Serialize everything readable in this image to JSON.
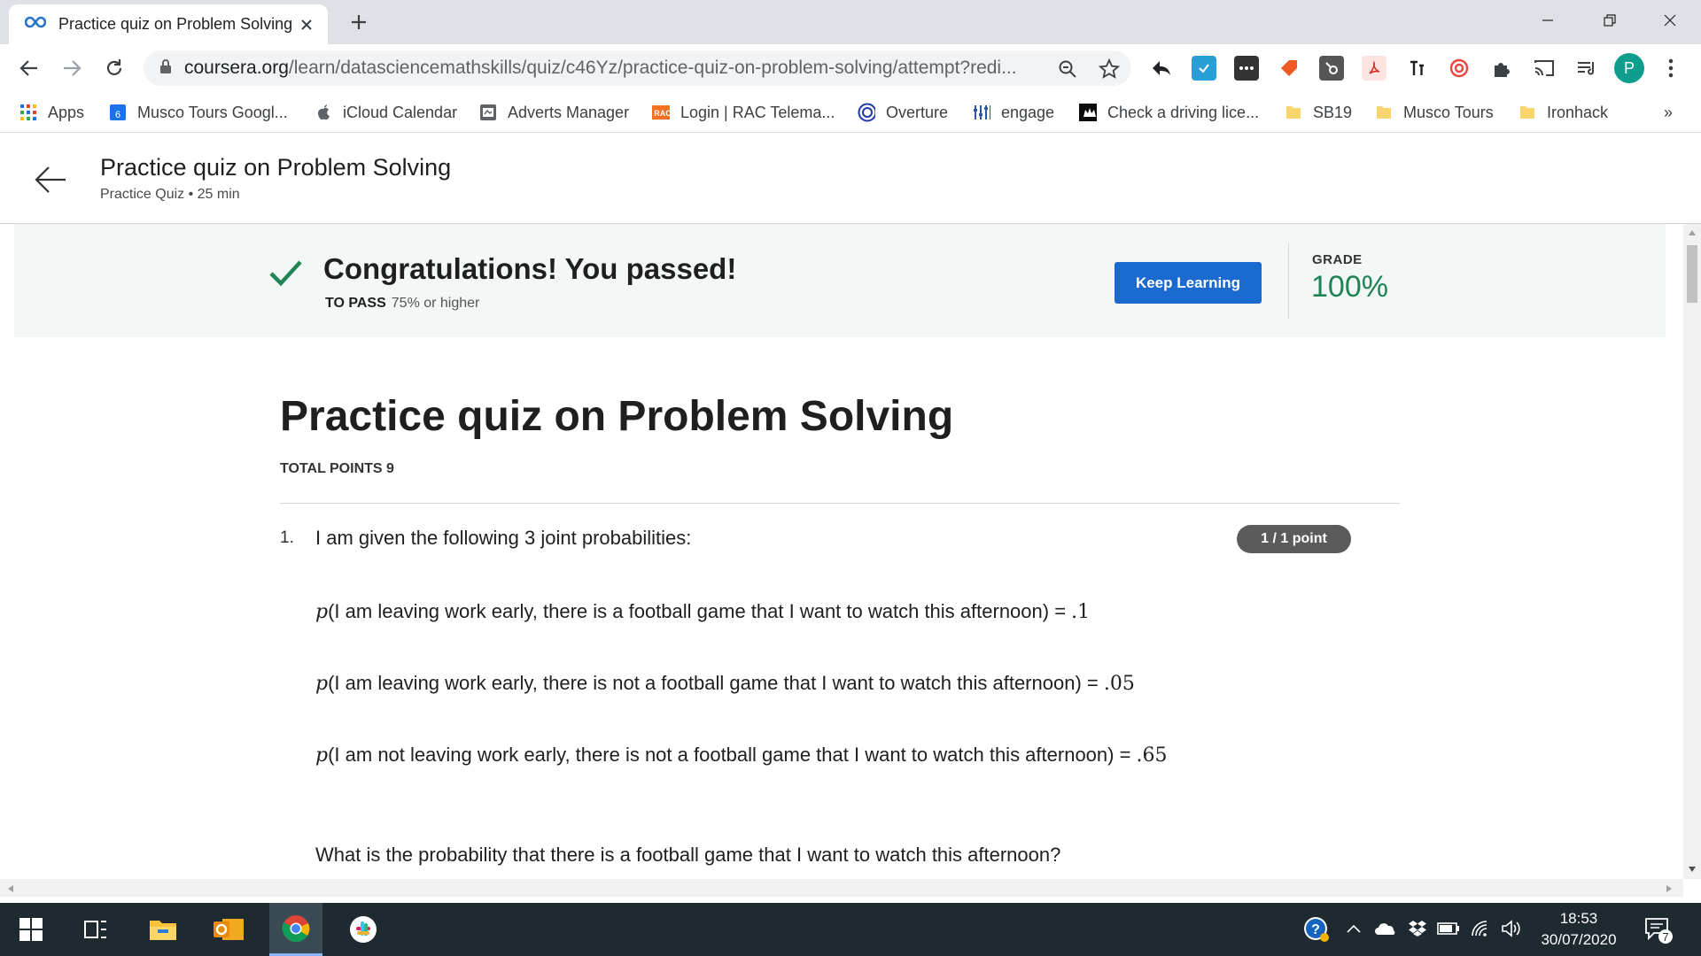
{
  "browser": {
    "tab_title": "Practice quiz on Problem Solving",
    "url_main": "coursera.org",
    "url_rest": "/learn/datasciencemathskills/quiz/c46Yz/practice-quiz-on-problem-solving/attempt?redi...",
    "profile_initial": "P",
    "bookmarks": [
      {
        "label": "Apps",
        "icon": "apps-grid-icon"
      },
      {
        "label": "Musco Tours Googl...",
        "icon": "google-calendar-icon"
      },
      {
        "label": "iCloud Calendar",
        "icon": "apple-icon"
      },
      {
        "label": "Adverts Manager",
        "icon": "adverts-icon"
      },
      {
        "label": "Login | RAC Telema...",
        "icon": "rac-icon"
      },
      {
        "label": "Overture",
        "icon": "overture-icon"
      },
      {
        "label": "engage",
        "icon": "engage-icon"
      },
      {
        "label": "Check a driving lice...",
        "icon": "gov-crown-icon"
      },
      {
        "label": "SB19",
        "icon": "folder-icon"
      },
      {
        "label": "Musco Tours",
        "icon": "folder-icon"
      },
      {
        "label": "Ironhack",
        "icon": "folder-icon"
      }
    ],
    "bookmarks_overflow": "»"
  },
  "header": {
    "title": "Practice quiz on Problem Solving",
    "subtitle": "Practice Quiz • 25 min"
  },
  "banner": {
    "title": "Congratulations! You passed!",
    "to_pass_label": "TO PASS",
    "to_pass_value": "75% or higher",
    "button": "Keep Learning",
    "grade_label": "GRADE",
    "grade_value": "100%",
    "accent_green": "#1f8354",
    "button_blue": "#1b6ad0"
  },
  "quiz": {
    "title": "Practice quiz on Problem Solving",
    "total_points": "TOTAL POINTS 9",
    "question_number": "1.",
    "question_text": "I am given the following 3 joint probabilities:",
    "points_badge": "1 / 1 point",
    "statements": [
      {
        "fn": "p",
        "text": "(I am leaving work early, there is a football game that I want to watch this afternoon) = ",
        "value": ".1"
      },
      {
        "fn": "p",
        "text": "(I am leaving work early, there is not a football game that I want to watch this afternoon) = ",
        "value": ".05"
      },
      {
        "fn": "p",
        "text": "(I am not leaving work early, there is not a football game that I want to watch this afternoon) = ",
        "value": ".65"
      }
    ],
    "question_prompt": "What is the probability that there is a football game that I want to watch this afternoon?"
  },
  "taskbar": {
    "time": "18:53",
    "date": "30/07/2020",
    "notification_count": "7"
  }
}
